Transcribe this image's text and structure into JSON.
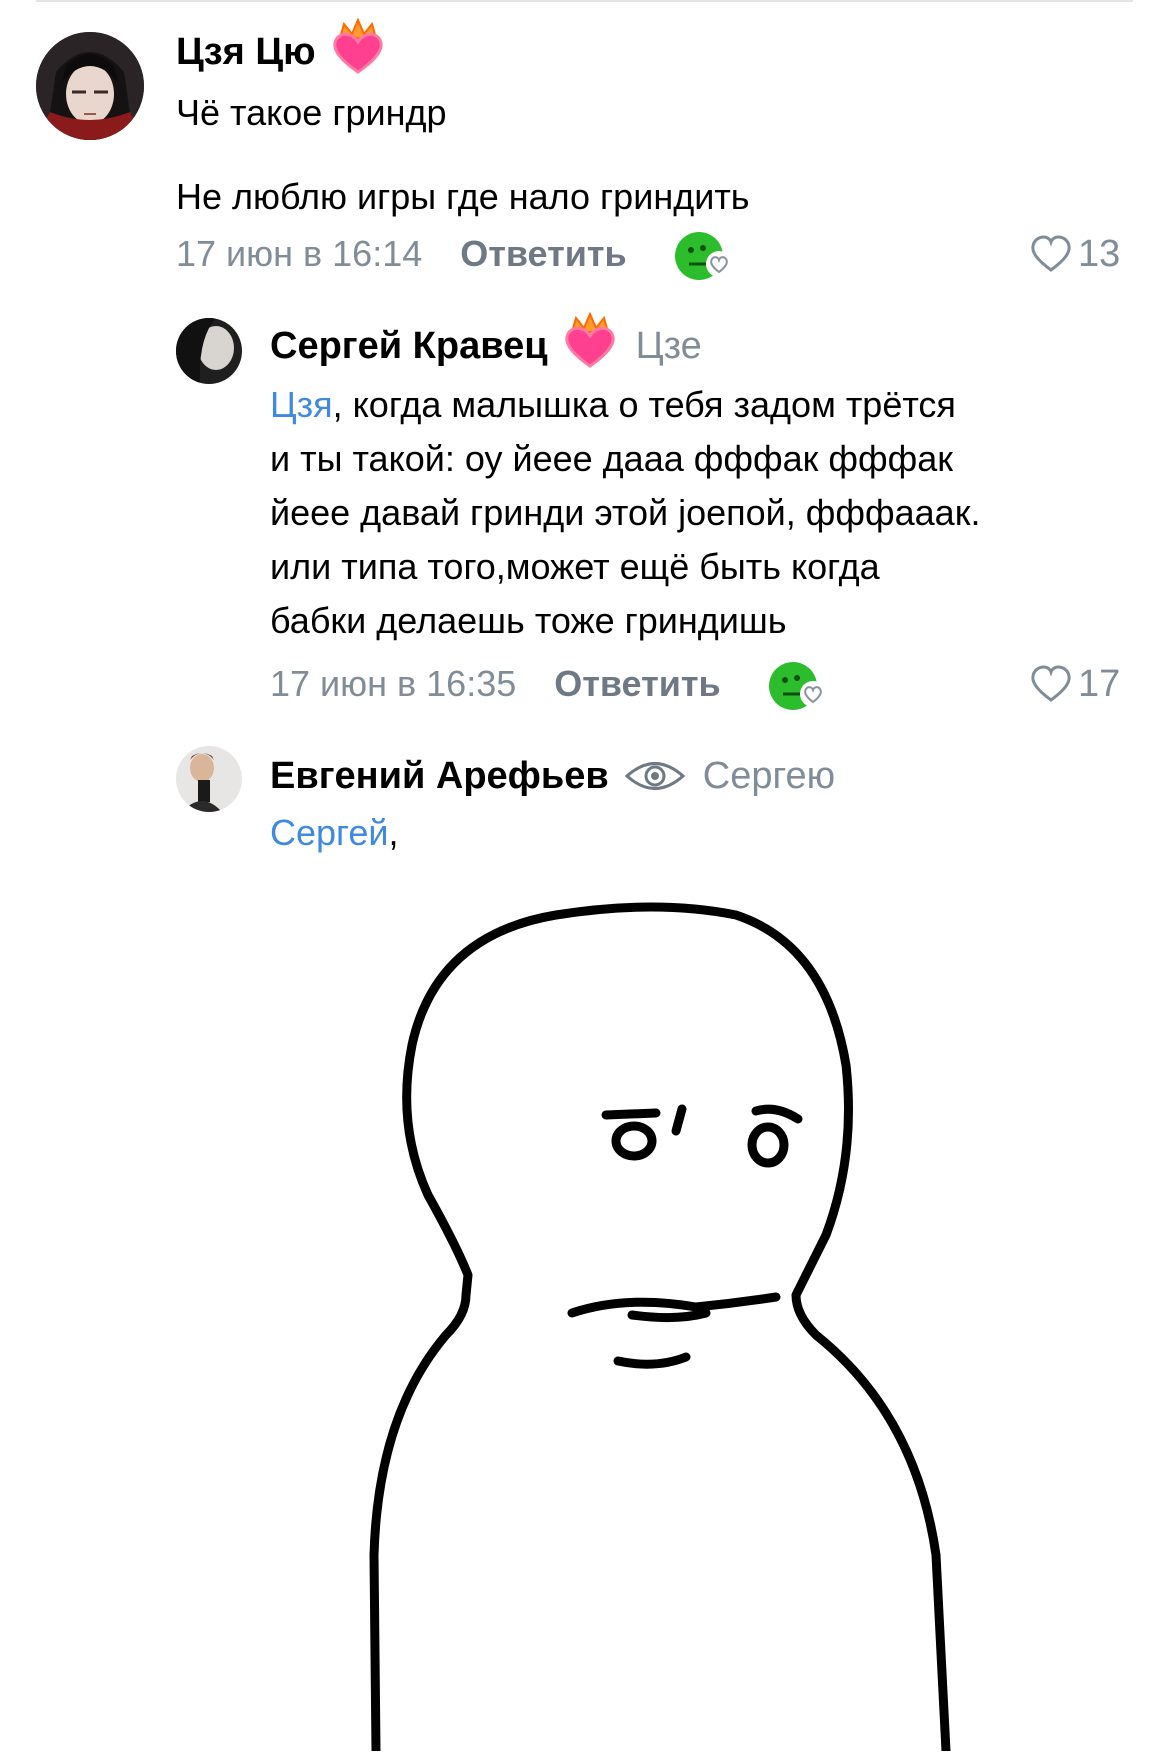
{
  "comments": [
    {
      "author": "Цзя Цю",
      "lines": [
        "Чё такое гриндр",
        "Не люблю игры где нало гриндить"
      ],
      "date": "17 июн в 16:14",
      "reply_label": "Ответить",
      "likes": "13"
    },
    {
      "author": "Сергей Кравец",
      "reply_to": "Цзе",
      "mention": "Цзя",
      "text_after_mention": ", когда малышка о тебя задом трётся",
      "lines": [
        "и ты такой: оу йеее дааа фффак фффак",
        "йеее давай гринди этой jоепой, фффааак.",
        "или типа того,может ещё быть когда",
        "бабки делаешь тоже гриндишь"
      ],
      "date": "17 июн в 16:35",
      "reply_label": "Ответить",
      "likes": "17"
    },
    {
      "author": "Евгений Арефьев",
      "reply_to": "Сергею",
      "mention": "Сергей",
      "text_after_mention": ","
    }
  ],
  "icons": {
    "badge": "flame-heart-icon",
    "reaction": "green-face-reaction-icon",
    "like": "heart-outline-icon",
    "eye": "eye-icon"
  },
  "colors": {
    "link": "#3f8ae0",
    "meta": "#818c99",
    "badge_heart": "#ff3f8f",
    "reaction_green": "#2bbd2b"
  }
}
